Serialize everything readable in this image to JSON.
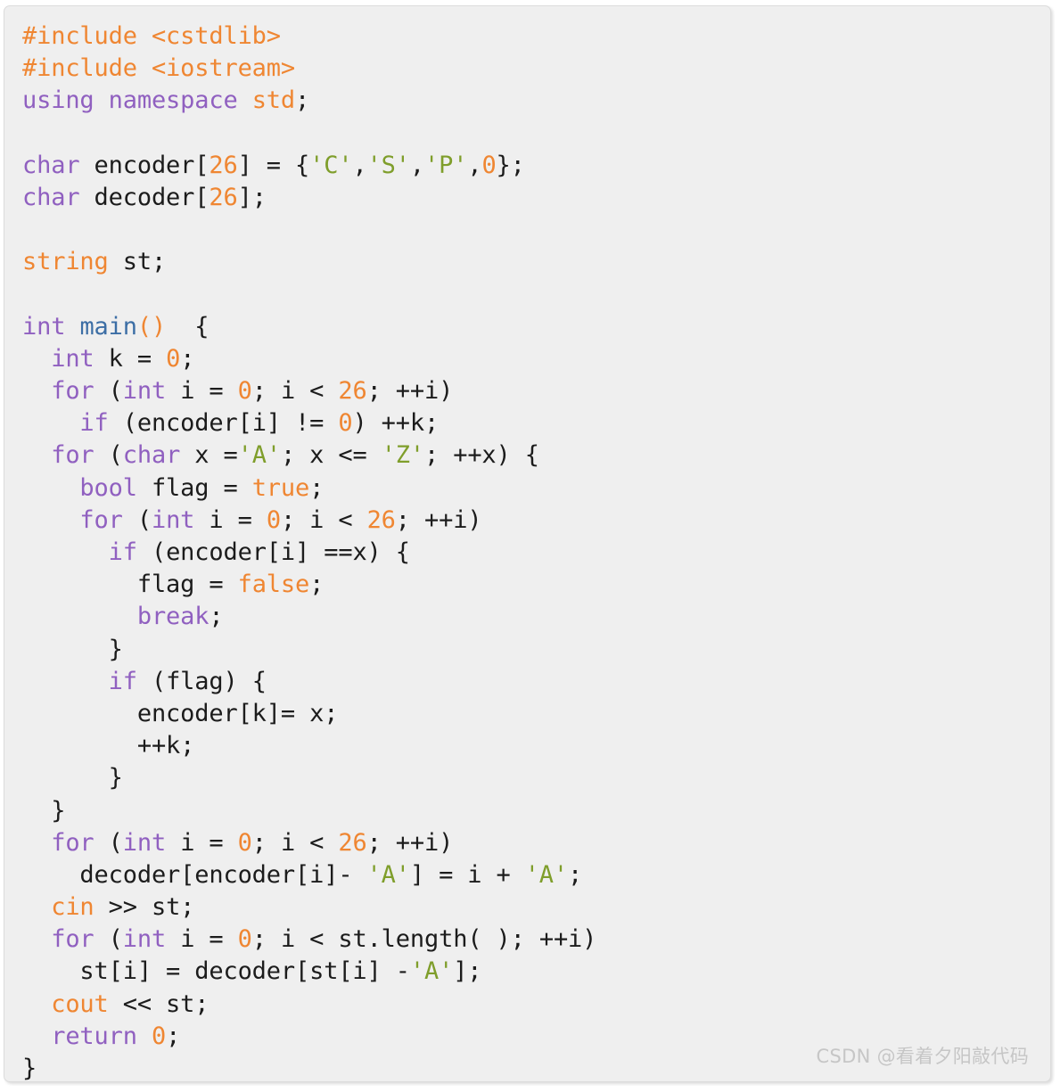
{
  "card": {
    "background_color": "#efefef",
    "border_color": "#dcdcdc"
  },
  "theme": {
    "keyword_color": "#9060c0",
    "preprocessor_color": "#ef8632",
    "number_color": "#ef8632",
    "literal_color": "#ef8632",
    "namespace_color": "#ef8632",
    "function_color": "#3c6ea5",
    "char_literal_color": "#7f9e2b",
    "plain_text_color": "#1c1c1c",
    "watermark_color": "#c6c6c6"
  },
  "language": "C++",
  "watermark": {
    "text": "CSDN @看着夕阳敲代码"
  },
  "code": {
    "lines": [
      {
        "n": 1,
        "text": "#include <cstdlib>"
      },
      {
        "n": 2,
        "text": "#include <iostream>"
      },
      {
        "n": 3,
        "text": "using namespace std;"
      },
      {
        "n": 4,
        "text": ""
      },
      {
        "n": 5,
        "text": "char encoder[26] = {'C','S','P',0};"
      },
      {
        "n": 6,
        "text": "char decoder[26];"
      },
      {
        "n": 7,
        "text": ""
      },
      {
        "n": 8,
        "text": "string st;"
      },
      {
        "n": 9,
        "text": ""
      },
      {
        "n": 10,
        "text": "int main()  {"
      },
      {
        "n": 11,
        "text": "  int k = 0;"
      },
      {
        "n": 12,
        "text": "  for (int i = 0; i < 26; ++i)"
      },
      {
        "n": 13,
        "text": "    if (encoder[i] != 0) ++k;"
      },
      {
        "n": 14,
        "text": "  for (char x ='A'; x <= 'Z'; ++x) {"
      },
      {
        "n": 15,
        "text": "    bool flag = true;"
      },
      {
        "n": 16,
        "text": "    for (int i = 0; i < 26; ++i)"
      },
      {
        "n": 17,
        "text": "      if (encoder[i] ==x) {"
      },
      {
        "n": 18,
        "text": "        flag = false;"
      },
      {
        "n": 19,
        "text": "        break;"
      },
      {
        "n": 20,
        "text": "      }"
      },
      {
        "n": 21,
        "text": "      if (flag) {"
      },
      {
        "n": 22,
        "text": "        encoder[k]= x;"
      },
      {
        "n": 23,
        "text": "        ++k;"
      },
      {
        "n": 24,
        "text": "      }"
      },
      {
        "n": 25,
        "text": "  }"
      },
      {
        "n": 26,
        "text": "  for (int i = 0; i < 26; ++i)"
      },
      {
        "n": 27,
        "text": "    decoder[encoder[i]- 'A'] = i + 'A';"
      },
      {
        "n": 28,
        "text": "  cin >> st;"
      },
      {
        "n": 29,
        "text": "  for (int i = 0; i < st.length( ); ++i)"
      },
      {
        "n": 30,
        "text": "    st[i] = decoder[st[i] -'A'];"
      },
      {
        "n": 31,
        "text": "  cout << st;"
      },
      {
        "n": 32,
        "text": "  return 0;"
      },
      {
        "n": 33,
        "text": "}"
      }
    ],
    "tokens": [
      [
        {
          "t": "#include <cstdlib>",
          "c": "tk-pre"
        }
      ],
      [
        {
          "t": "#include <iostream>",
          "c": "tk-pre"
        }
      ],
      [
        {
          "t": "using namespace ",
          "c": "tk-kw"
        },
        {
          "t": "std",
          "c": "tk-ns"
        },
        {
          "t": ";",
          "c": "tk-plain"
        }
      ],
      [],
      [
        {
          "t": "char",
          "c": "tk-kw"
        },
        {
          "t": " encoder[",
          "c": "tk-plain"
        },
        {
          "t": "26",
          "c": "tk-num"
        },
        {
          "t": "] = {",
          "c": "tk-plain"
        },
        {
          "t": "'C'",
          "c": "tk-str"
        },
        {
          "t": ",",
          "c": "tk-plain"
        },
        {
          "t": "'S'",
          "c": "tk-str"
        },
        {
          "t": ",",
          "c": "tk-plain"
        },
        {
          "t": "'P'",
          "c": "tk-str"
        },
        {
          "t": ",",
          "c": "tk-plain"
        },
        {
          "t": "0",
          "c": "tk-num"
        },
        {
          "t": "};",
          "c": "tk-plain"
        }
      ],
      [
        {
          "t": "char",
          "c": "tk-kw"
        },
        {
          "t": " decoder[",
          "c": "tk-plain"
        },
        {
          "t": "26",
          "c": "tk-num"
        },
        {
          "t": "];",
          "c": "tk-plain"
        }
      ],
      [],
      [
        {
          "t": "string",
          "c": "tk-ns"
        },
        {
          "t": " st;",
          "c": "tk-plain"
        }
      ],
      [],
      [
        {
          "t": "int",
          "c": "tk-kw"
        },
        {
          "t": " ",
          "c": "tk-plain"
        },
        {
          "t": "main",
          "c": "tk-fn"
        },
        {
          "t": "()",
          "c": "tk-paren"
        },
        {
          "t": "  {",
          "c": "tk-plain"
        }
      ],
      [
        {
          "t": "  ",
          "c": "tk-plain"
        },
        {
          "t": "int",
          "c": "tk-kw"
        },
        {
          "t": " k = ",
          "c": "tk-plain"
        },
        {
          "t": "0",
          "c": "tk-num"
        },
        {
          "t": ";",
          "c": "tk-plain"
        }
      ],
      [
        {
          "t": "  ",
          "c": "tk-plain"
        },
        {
          "t": "for",
          "c": "tk-kw"
        },
        {
          "t": " (",
          "c": "tk-plain"
        },
        {
          "t": "int",
          "c": "tk-kw"
        },
        {
          "t": " i = ",
          "c": "tk-plain"
        },
        {
          "t": "0",
          "c": "tk-num"
        },
        {
          "t": "; i < ",
          "c": "tk-plain"
        },
        {
          "t": "26",
          "c": "tk-num"
        },
        {
          "t": "; ++i)",
          "c": "tk-plain"
        }
      ],
      [
        {
          "t": "    ",
          "c": "tk-plain"
        },
        {
          "t": "if",
          "c": "tk-kw"
        },
        {
          "t": " (encoder[i] != ",
          "c": "tk-plain"
        },
        {
          "t": "0",
          "c": "tk-num"
        },
        {
          "t": ") ++k;",
          "c": "tk-plain"
        }
      ],
      [
        {
          "t": "  ",
          "c": "tk-plain"
        },
        {
          "t": "for",
          "c": "tk-kw"
        },
        {
          "t": " (",
          "c": "tk-plain"
        },
        {
          "t": "char",
          "c": "tk-kw"
        },
        {
          "t": " x =",
          "c": "tk-plain"
        },
        {
          "t": "'A'",
          "c": "tk-str"
        },
        {
          "t": "; x <= ",
          "c": "tk-plain"
        },
        {
          "t": "'Z'",
          "c": "tk-str"
        },
        {
          "t": "; ++x) {",
          "c": "tk-plain"
        }
      ],
      [
        {
          "t": "    ",
          "c": "tk-plain"
        },
        {
          "t": "bool",
          "c": "tk-kw"
        },
        {
          "t": " flag = ",
          "c": "tk-plain"
        },
        {
          "t": "true",
          "c": "tk-lit"
        },
        {
          "t": ";",
          "c": "tk-plain"
        }
      ],
      [
        {
          "t": "    ",
          "c": "tk-plain"
        },
        {
          "t": "for",
          "c": "tk-kw"
        },
        {
          "t": " (",
          "c": "tk-plain"
        },
        {
          "t": "int",
          "c": "tk-kw"
        },
        {
          "t": " i = ",
          "c": "tk-plain"
        },
        {
          "t": "0",
          "c": "tk-num"
        },
        {
          "t": "; i < ",
          "c": "tk-plain"
        },
        {
          "t": "26",
          "c": "tk-num"
        },
        {
          "t": "; ++i)",
          "c": "tk-plain"
        }
      ],
      [
        {
          "t": "      ",
          "c": "tk-plain"
        },
        {
          "t": "if",
          "c": "tk-kw"
        },
        {
          "t": " (encoder[i] ==x) {",
          "c": "tk-plain"
        }
      ],
      [
        {
          "t": "        flag = ",
          "c": "tk-plain"
        },
        {
          "t": "false",
          "c": "tk-lit"
        },
        {
          "t": ";",
          "c": "tk-plain"
        }
      ],
      [
        {
          "t": "        ",
          "c": "tk-plain"
        },
        {
          "t": "break",
          "c": "tk-kw"
        },
        {
          "t": ";",
          "c": "tk-plain"
        }
      ],
      [
        {
          "t": "      }",
          "c": "tk-plain"
        }
      ],
      [
        {
          "t": "      ",
          "c": "tk-plain"
        },
        {
          "t": "if",
          "c": "tk-kw"
        },
        {
          "t": " (flag) {",
          "c": "tk-plain"
        }
      ],
      [
        {
          "t": "        encoder[k]= x;",
          "c": "tk-plain"
        }
      ],
      [
        {
          "t": "        ++k;",
          "c": "tk-plain"
        }
      ],
      [
        {
          "t": "      }",
          "c": "tk-plain"
        }
      ],
      [
        {
          "t": "  }",
          "c": "tk-plain"
        }
      ],
      [
        {
          "t": "  ",
          "c": "tk-plain"
        },
        {
          "t": "for",
          "c": "tk-kw"
        },
        {
          "t": " (",
          "c": "tk-plain"
        },
        {
          "t": "int",
          "c": "tk-kw"
        },
        {
          "t": " i = ",
          "c": "tk-plain"
        },
        {
          "t": "0",
          "c": "tk-num"
        },
        {
          "t": "; i < ",
          "c": "tk-plain"
        },
        {
          "t": "26",
          "c": "tk-num"
        },
        {
          "t": "; ++i)",
          "c": "tk-plain"
        }
      ],
      [
        {
          "t": "    decoder[encoder[i]- ",
          "c": "tk-plain"
        },
        {
          "t": "'A'",
          "c": "tk-str"
        },
        {
          "t": "] = i + ",
          "c": "tk-plain"
        },
        {
          "t": "'A'",
          "c": "tk-str"
        },
        {
          "t": ";",
          "c": "tk-plain"
        }
      ],
      [
        {
          "t": "  ",
          "c": "tk-plain"
        },
        {
          "t": "cin",
          "c": "tk-ns"
        },
        {
          "t": " >> st;",
          "c": "tk-plain"
        }
      ],
      [
        {
          "t": "  ",
          "c": "tk-plain"
        },
        {
          "t": "for",
          "c": "tk-kw"
        },
        {
          "t": " (",
          "c": "tk-plain"
        },
        {
          "t": "int",
          "c": "tk-kw"
        },
        {
          "t": " i = ",
          "c": "tk-plain"
        },
        {
          "t": "0",
          "c": "tk-num"
        },
        {
          "t": "; i < st.length( ); ++i)",
          "c": "tk-plain"
        }
      ],
      [
        {
          "t": "    st[i] = decoder[st[i] -",
          "c": "tk-plain"
        },
        {
          "t": "'A'",
          "c": "tk-str"
        },
        {
          "t": "];",
          "c": "tk-plain"
        }
      ],
      [
        {
          "t": "  ",
          "c": "tk-plain"
        },
        {
          "t": "cout",
          "c": "tk-ns"
        },
        {
          "t": " << st;",
          "c": "tk-plain"
        }
      ],
      [
        {
          "t": "  ",
          "c": "tk-plain"
        },
        {
          "t": "return",
          "c": "tk-kw"
        },
        {
          "t": " ",
          "c": "tk-plain"
        },
        {
          "t": "0",
          "c": "tk-num"
        },
        {
          "t": ";",
          "c": "tk-plain"
        }
      ],
      [
        {
          "t": "}",
          "c": "tk-plain"
        }
      ]
    ]
  }
}
